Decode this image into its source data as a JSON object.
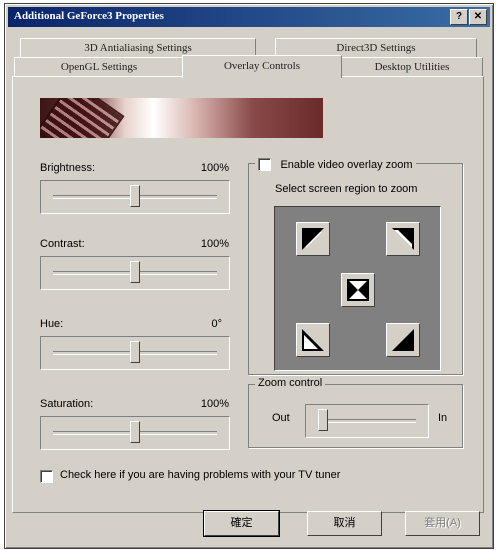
{
  "window": {
    "title": "Additional GeForce3 Properties",
    "help_label": "?",
    "close_label": "✕"
  },
  "tabs": {
    "row1": [
      {
        "label": "3D Antialiasing Settings"
      },
      {
        "label": "Direct3D Settings"
      }
    ],
    "row2": [
      {
        "label": "OpenGL Settings"
      },
      {
        "label": "Overlay Controls"
      },
      {
        "label": "Desktop Utilities"
      }
    ],
    "active": "Overlay Controls"
  },
  "sliders": [
    {
      "label": "Brightness:",
      "value": "100%",
      "level": 0.5
    },
    {
      "label": "Contrast:",
      "value": "100%",
      "level": 0.5
    },
    {
      "label": "Hue:",
      "value": "0°",
      "level": 0.5
    },
    {
      "label": "Saturation:",
      "value": "100%",
      "level": 0.5
    }
  ],
  "zoom": {
    "enable_label": "Enable video overlay zoom",
    "enabled": false,
    "region_label": "Select screen region to zoom",
    "region_buttons": [
      "top-left-icon",
      "top-right-icon",
      "center-icon",
      "bottom-left-icon",
      "bottom-right-icon"
    ],
    "control_label": "Zoom control",
    "out_label": "Out",
    "in_label": "In",
    "level": 0.0
  },
  "tv_tuner": {
    "label": "Check here if you are having problems with your TV tuner",
    "checked": false
  },
  "buttons": {
    "ok": "確定",
    "cancel": "取消",
    "apply": "套用(A)"
  }
}
